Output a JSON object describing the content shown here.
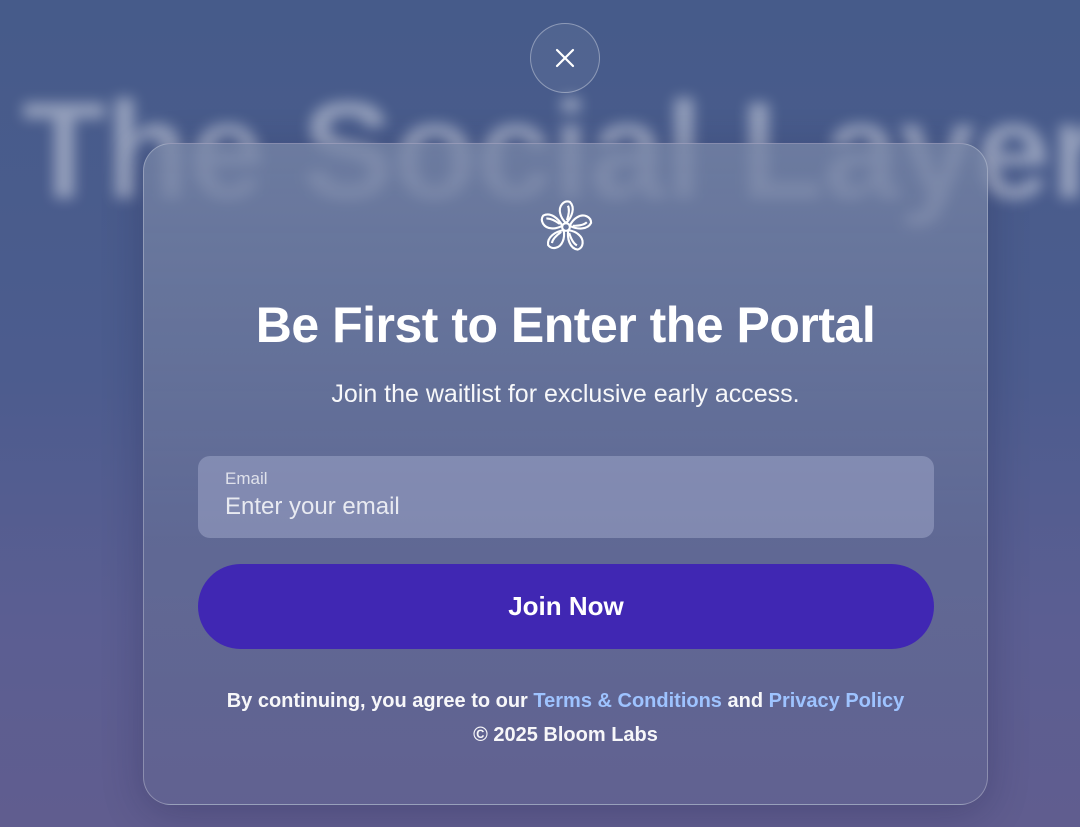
{
  "background": {
    "title": "The Social Layer"
  },
  "close": {
    "icon": "close-icon"
  },
  "modal": {
    "logo_icon": "flower-logo-icon",
    "title": "Be First to Enter the Portal",
    "subtitle": "Join the waitlist for exclusive early access.",
    "email": {
      "label": "Email",
      "placeholder": "Enter your email",
      "value": ""
    },
    "join_label": "Join Now",
    "legal": {
      "prefix": "By continuing, you agree to our ",
      "terms_label": "Terms & Conditions",
      "connector": " and ",
      "privacy_label": "Privacy Policy"
    },
    "copyright": "© 2025 Bloom Labs"
  },
  "colors": {
    "accent_button": "#4027b3",
    "link": "#9ec3ff"
  }
}
